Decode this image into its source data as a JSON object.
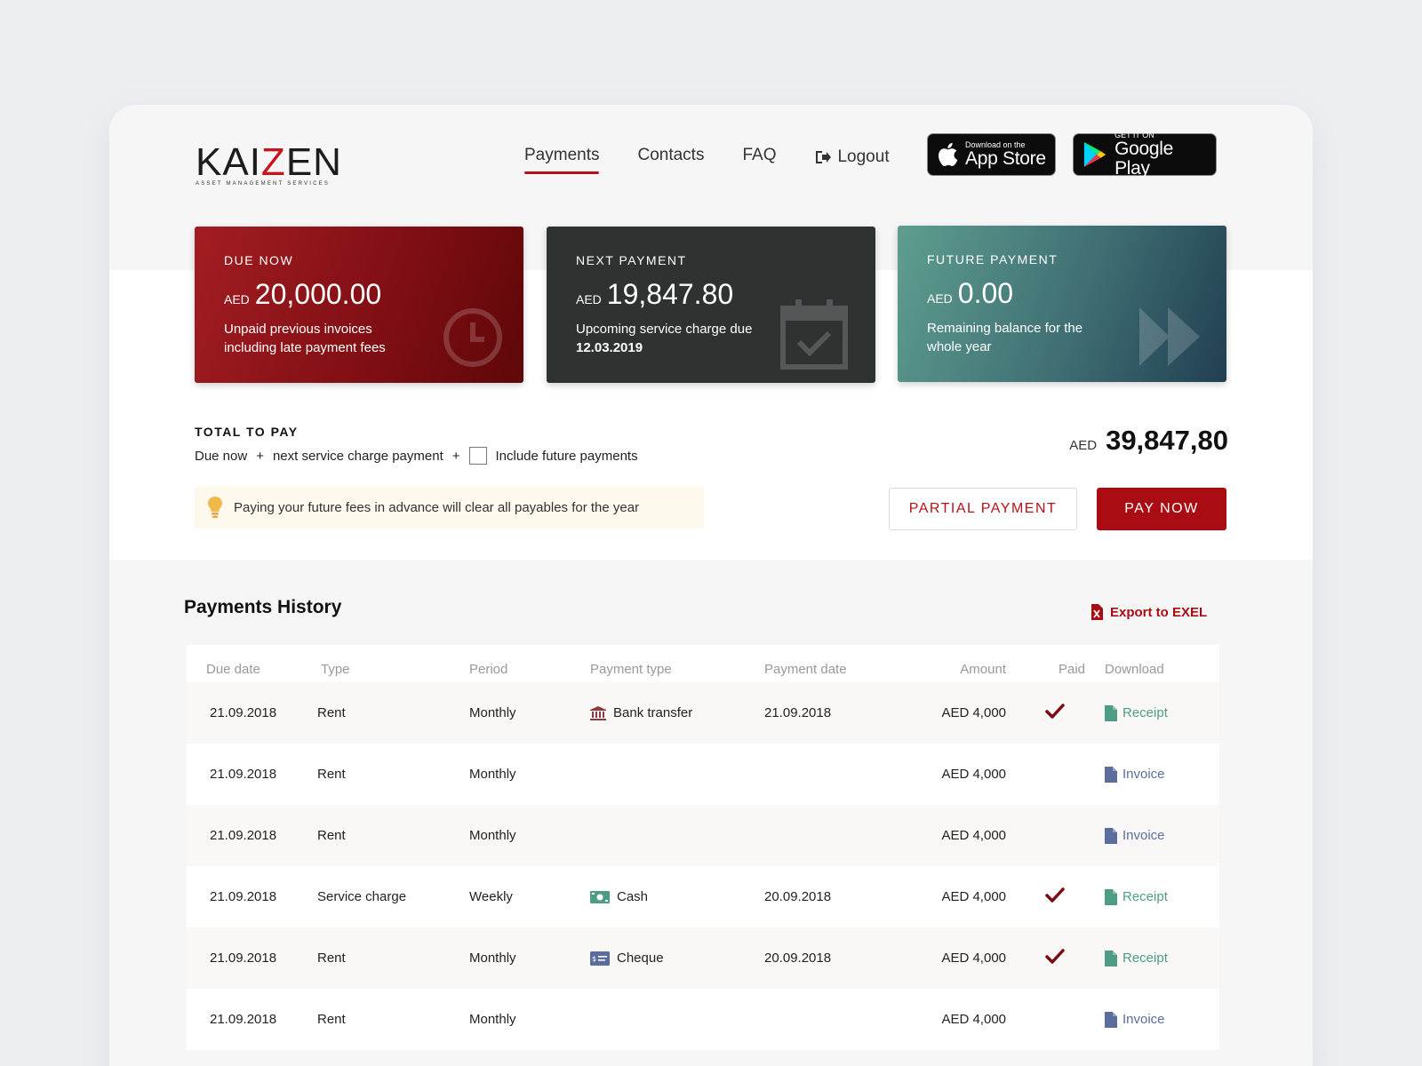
{
  "brand": {
    "name_prefix": "KAI",
    "name_z": "Z",
    "name_suffix": "EN",
    "tagline": "ASSET MANAGEMENT SERVICES"
  },
  "nav": {
    "items": [
      "Payments",
      "Contacts",
      "FAQ"
    ],
    "active": "Payments",
    "logout": "Logout"
  },
  "stores": {
    "apple": {
      "small": "Download on the",
      "big": "App Store"
    },
    "google": {
      "small": "GET IT ON",
      "big": "Google Play"
    }
  },
  "cards": {
    "due": {
      "label": "DUE NOW",
      "currency": "AED",
      "amount": "20,000.00",
      "desc": "Unpaid previous invoices including late payment fees",
      "icon": "clock-icon"
    },
    "next": {
      "label": "NEXT PAYMENT",
      "currency": "AED",
      "amount": "19,847.80",
      "desc_prefix": "Upcoming service charge due",
      "desc_date": "12.03.2019",
      "icon": "calendar-check-icon"
    },
    "future": {
      "label": "FUTURE PAYMENT",
      "currency": "AED",
      "amount": "0.00",
      "desc": "Remaining balance for the whole year",
      "icon": "fast-forward-icon"
    }
  },
  "total": {
    "title": "TOTAL TO PAY",
    "part1": "Due now",
    "plus": "+",
    "part2": "next service charge payment",
    "checkbox_label": "Include future payments",
    "checkbox_checked": false,
    "currency": "AED",
    "amount": "39,847,80"
  },
  "tip": {
    "text": "Paying  your future fees in advance will clear all payables for the year",
    "icon": "lightbulb-icon"
  },
  "actions": {
    "partial": "PARTIAL PAYMENT",
    "pay": "PAY NOW"
  },
  "history": {
    "title": "Payments History",
    "export": "Export to EXEL",
    "columns": [
      "Due date",
      "Type",
      "Period",
      "Payment type",
      "Payment date",
      "Amount",
      "Paid",
      "Download"
    ],
    "rows": [
      {
        "due": "21.09.2018",
        "type": "Rent",
        "period": "Monthly",
        "ptype": "Bank transfer",
        "picon": "bank-icon",
        "pdate": "21.09.2018",
        "amount": "AED 4,000",
        "paid": true,
        "download": "Receipt"
      },
      {
        "due": "21.09.2018",
        "type": "Rent",
        "period": "Monthly",
        "ptype": "",
        "picon": "",
        "pdate": "",
        "amount": "AED 4,000",
        "paid": false,
        "download": "Invoice"
      },
      {
        "due": "21.09.2018",
        "type": "Rent",
        "period": "Monthly",
        "ptype": "",
        "picon": "",
        "pdate": "",
        "amount": "AED 4,000",
        "paid": false,
        "download": "Invoice"
      },
      {
        "due": "21.09.2018",
        "type": "Service charge",
        "period": "Weekly",
        "ptype": "Cash",
        "picon": "cash-icon",
        "pdate": "20.09.2018",
        "amount": "AED 4,000",
        "paid": true,
        "download": "Receipt"
      },
      {
        "due": "21.09.2018",
        "type": "Rent",
        "period": "Monthly",
        "ptype": "Cheque",
        "picon": "cheque-icon",
        "pdate": "20.09.2018",
        "amount": "AED 4,000",
        "paid": true,
        "download": "Receipt"
      },
      {
        "due": "21.09.2018",
        "type": "Rent",
        "period": "Monthly",
        "ptype": "",
        "picon": "",
        "pdate": "",
        "amount": "AED 4,000",
        "paid": false,
        "download": "Invoice"
      }
    ]
  },
  "colors": {
    "brand_red": "#a90c13",
    "receipt": "#4f9c86",
    "invoice": "#5b6d9c",
    "check": "#7a0c10"
  }
}
